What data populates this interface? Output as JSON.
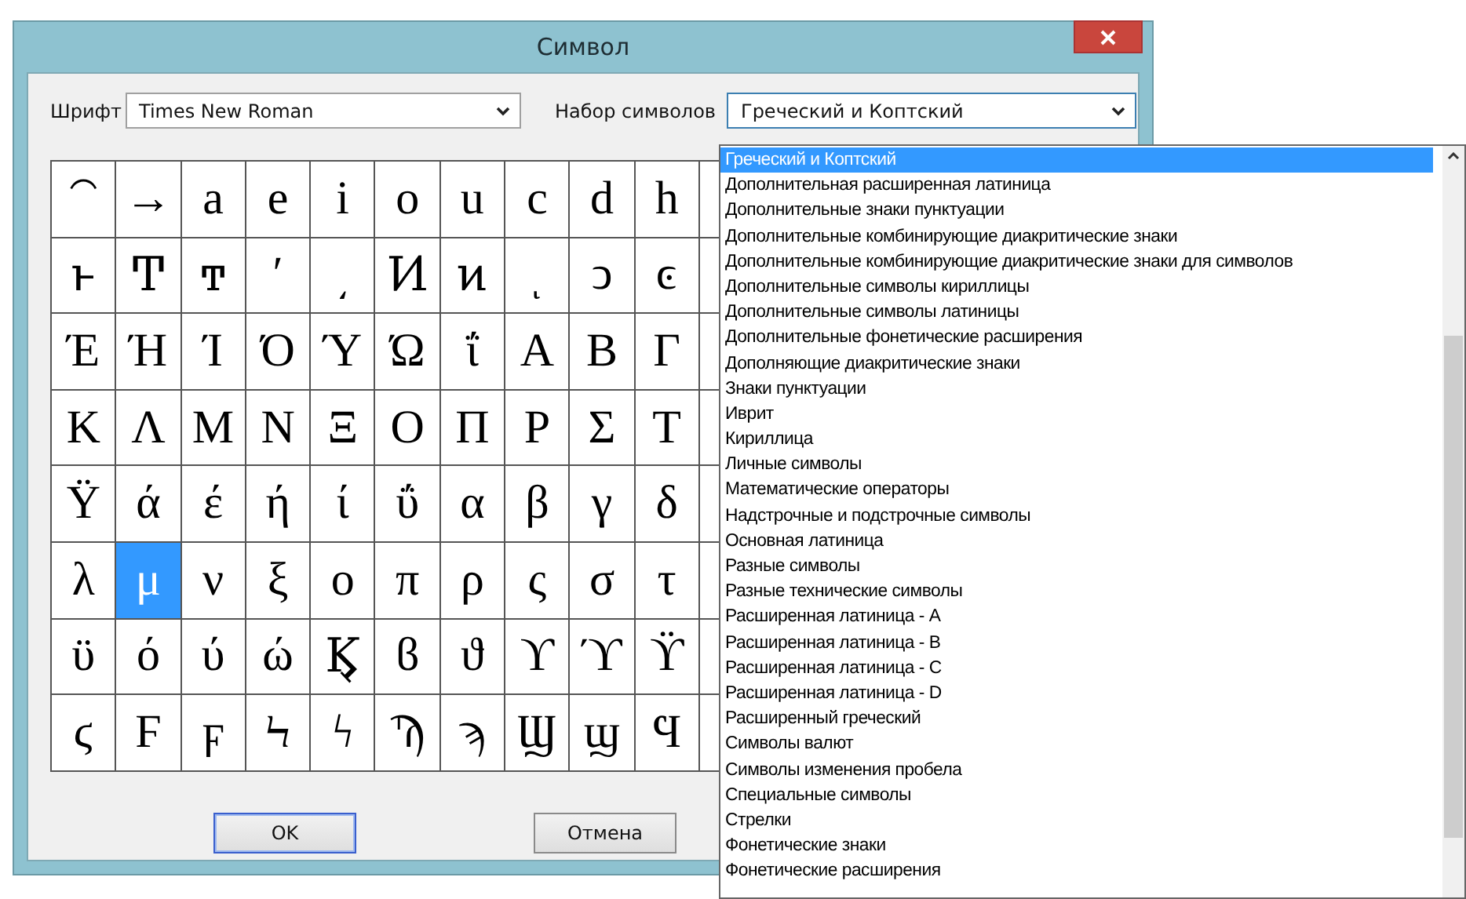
{
  "window": {
    "title": "Символ"
  },
  "font": {
    "label": "Шрифт",
    "value": "Times New Roman"
  },
  "subset": {
    "label": "Набор символов",
    "value": "Греческий и Коптский",
    "expanded": true
  },
  "grid": [
    [
      {
        "char": "⁀",
        "selected": false
      },
      {
        "char": "→",
        "selected": false
      },
      {
        "char": "a",
        "selected": false
      },
      {
        "char": "e",
        "selected": false
      },
      {
        "char": "i",
        "selected": false
      },
      {
        "char": "o",
        "selected": false
      },
      {
        "char": "u",
        "selected": false
      },
      {
        "char": "c",
        "selected": false
      },
      {
        "char": "d",
        "selected": false
      },
      {
        "char": "h",
        "selected": false
      }
    ],
    [
      {
        "char": "ͱ",
        "selected": false
      },
      {
        "char": "Ͳ",
        "selected": false
      },
      {
        "char": "ͳ",
        "selected": false
      },
      {
        "char": "ʹ",
        "selected": false
      },
      {
        "char": "͵",
        "selected": false
      },
      {
        "char": "Ͷ",
        "selected": false
      },
      {
        "char": "ͷ",
        "selected": false
      },
      {
        "char": "ͺ",
        "selected": false
      },
      {
        "char": "ͻ",
        "selected": false
      },
      {
        "char": "ͼ",
        "selected": false
      }
    ],
    [
      {
        "char": "Έ",
        "selected": false
      },
      {
        "char": "Ή",
        "selected": false
      },
      {
        "char": "Ί",
        "selected": false
      },
      {
        "char": "Ό",
        "selected": false
      },
      {
        "char": "Ύ",
        "selected": false
      },
      {
        "char": "Ώ",
        "selected": false
      },
      {
        "char": "ΐ",
        "selected": false
      },
      {
        "char": "Α",
        "selected": false
      },
      {
        "char": "Β",
        "selected": false
      },
      {
        "char": "Γ",
        "selected": false
      }
    ],
    [
      {
        "char": "Κ",
        "selected": false
      },
      {
        "char": "Λ",
        "selected": false
      },
      {
        "char": "Μ",
        "selected": false
      },
      {
        "char": "Ν",
        "selected": false
      },
      {
        "char": "Ξ",
        "selected": false
      },
      {
        "char": "Ο",
        "selected": false
      },
      {
        "char": "Π",
        "selected": false
      },
      {
        "char": "Ρ",
        "selected": false
      },
      {
        "char": "Σ",
        "selected": false
      },
      {
        "char": "Τ",
        "selected": false
      }
    ],
    [
      {
        "char": "Ϋ",
        "selected": false
      },
      {
        "char": "ά",
        "selected": false
      },
      {
        "char": "έ",
        "selected": false
      },
      {
        "char": "ή",
        "selected": false
      },
      {
        "char": "ί",
        "selected": false
      },
      {
        "char": "ΰ",
        "selected": false
      },
      {
        "char": "α",
        "selected": false
      },
      {
        "char": "β",
        "selected": false
      },
      {
        "char": "γ",
        "selected": false
      },
      {
        "char": "δ",
        "selected": false
      }
    ],
    [
      {
        "char": "λ",
        "selected": false
      },
      {
        "char": "μ",
        "selected": true
      },
      {
        "char": "ν",
        "selected": false
      },
      {
        "char": "ξ",
        "selected": false
      },
      {
        "char": "ο",
        "selected": false
      },
      {
        "char": "π",
        "selected": false
      },
      {
        "char": "ρ",
        "selected": false
      },
      {
        "char": "ς",
        "selected": false
      },
      {
        "char": "σ",
        "selected": false
      },
      {
        "char": "τ",
        "selected": false
      }
    ],
    [
      {
        "char": "ϋ",
        "selected": false
      },
      {
        "char": "ό",
        "selected": false
      },
      {
        "char": "ύ",
        "selected": false
      },
      {
        "char": "ώ",
        "selected": false
      },
      {
        "char": "Ϗ",
        "selected": false
      },
      {
        "char": "ϐ",
        "selected": false
      },
      {
        "char": "ϑ",
        "selected": false
      },
      {
        "char": "ϒ",
        "selected": false
      },
      {
        "char": "ϓ",
        "selected": false
      },
      {
        "char": "ϔ",
        "selected": false
      }
    ],
    [
      {
        "char": "ϛ",
        "selected": false
      },
      {
        "char": "Ϝ",
        "selected": false
      },
      {
        "char": "ϝ",
        "selected": false
      },
      {
        "char": "Ϟ",
        "selected": false
      },
      {
        "char": "ϟ",
        "selected": false
      },
      {
        "char": "Ϡ",
        "selected": false
      },
      {
        "char": "ϡ",
        "selected": false
      },
      {
        "char": "Ϣ",
        "selected": false
      },
      {
        "char": "ϣ",
        "selected": false
      },
      {
        "char": "Ϥ",
        "selected": false
      }
    ]
  ],
  "buttons": [
    {
      "label": "OK",
      "default": true
    },
    {
      "label": "Отмена",
      "default": false
    }
  ],
  "subset_options": [
    {
      "label": "Греческий и Коптский",
      "selected": true
    },
    {
      "label": "Дополнительная расширенная латиница",
      "selected": false
    },
    {
      "label": "Дополнительные знаки пунктуации",
      "selected": false
    },
    {
      "label": "Дополнительные комбинирующие диакритические знаки",
      "selected": false
    },
    {
      "label": "Дополнительные комбинирующие диакритические знаки для символов",
      "selected": false
    },
    {
      "label": "Дополнительные символы кириллицы",
      "selected": false
    },
    {
      "label": "Дополнительные символы латиницы",
      "selected": false
    },
    {
      "label": "Дополнительные фонетические расширения",
      "selected": false
    },
    {
      "label": "Дополняющие диакритические знаки",
      "selected": false
    },
    {
      "label": "Знаки пунктуации",
      "selected": false
    },
    {
      "label": "Иврит",
      "selected": false
    },
    {
      "label": "Кириллица",
      "selected": false
    },
    {
      "label": "Личные символы",
      "selected": false
    },
    {
      "label": "Математические операторы",
      "selected": false
    },
    {
      "label": "Надстрочные и подстрочные символы",
      "selected": false
    },
    {
      "label": "Основная латиница",
      "selected": false
    },
    {
      "label": "Разные символы",
      "selected": false
    },
    {
      "label": "Разные технические символы",
      "selected": false
    },
    {
      "label": "Расширенная латиница - A",
      "selected": false
    },
    {
      "label": "Расширенная латиница - B",
      "selected": false
    },
    {
      "label": "Расширенная латиница - C",
      "selected": false
    },
    {
      "label": "Расширенная латиница - D",
      "selected": false
    },
    {
      "label": "Расширенный греческий",
      "selected": false
    },
    {
      "label": "Символы валют",
      "selected": false
    },
    {
      "label": "Символы изменения пробела",
      "selected": false
    },
    {
      "label": "Специальные символы",
      "selected": false
    },
    {
      "label": "Стрелки",
      "selected": false
    },
    {
      "label": "Фонетические знаки",
      "selected": false
    },
    {
      "label": "Фонетические расширения",
      "selected": false
    }
  ]
}
